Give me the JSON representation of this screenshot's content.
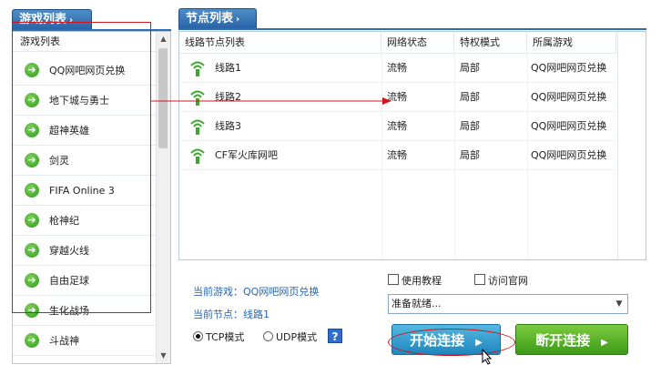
{
  "left_panel": {
    "tab_label": "游戏列表",
    "header": "游戏列表",
    "items": [
      {
        "label": "QQ网吧网页兑换"
      },
      {
        "label": "地下城与勇士"
      },
      {
        "label": "超神英雄"
      },
      {
        "label": "剑灵"
      },
      {
        "label": "FIFA Online 3"
      },
      {
        "label": "枪神纪"
      },
      {
        "label": "穿越火线"
      },
      {
        "label": "自由足球"
      },
      {
        "label": "生化战场"
      },
      {
        "label": "斗战神"
      }
    ]
  },
  "node_panel": {
    "tab_label": "节点列表",
    "columns": [
      "线路节点列表",
      "网络状态",
      "特权模式",
      "所属游戏"
    ],
    "rows": [
      {
        "name": "线路1",
        "status": "流畅",
        "mode": "局部",
        "game": "QQ网吧网页兑换"
      },
      {
        "name": "线路2",
        "status": "流畅",
        "mode": "局部",
        "game": "QQ网吧网页兑换"
      },
      {
        "name": "线路3",
        "status": "流畅",
        "mode": "局部",
        "game": "QQ网吧网页兑换"
      },
      {
        "name": "CF军火库网吧",
        "status": "流畅",
        "mode": "局部",
        "game": "QQ网吧网页兑换"
      }
    ]
  },
  "info": {
    "current_game": "当前游戏：QQ网吧网页兑换",
    "current_node": "当前节点：线路1",
    "tcp_label": "TCP模式",
    "udp_label": "UDP模式",
    "tutorial_label": "使用教程",
    "website_label": "访问官网",
    "status_text": "准备就绪...",
    "help_glyph": "?"
  },
  "buttons": {
    "start_label": "开始连接",
    "stop_label": "断开连接"
  },
  "colors": {
    "tab_blue": "#2f6db0",
    "info_blue": "#2a66b0",
    "start_button": "#1f86bf",
    "stop_button": "#3c9a18",
    "annotation_red": "#d0161c"
  }
}
